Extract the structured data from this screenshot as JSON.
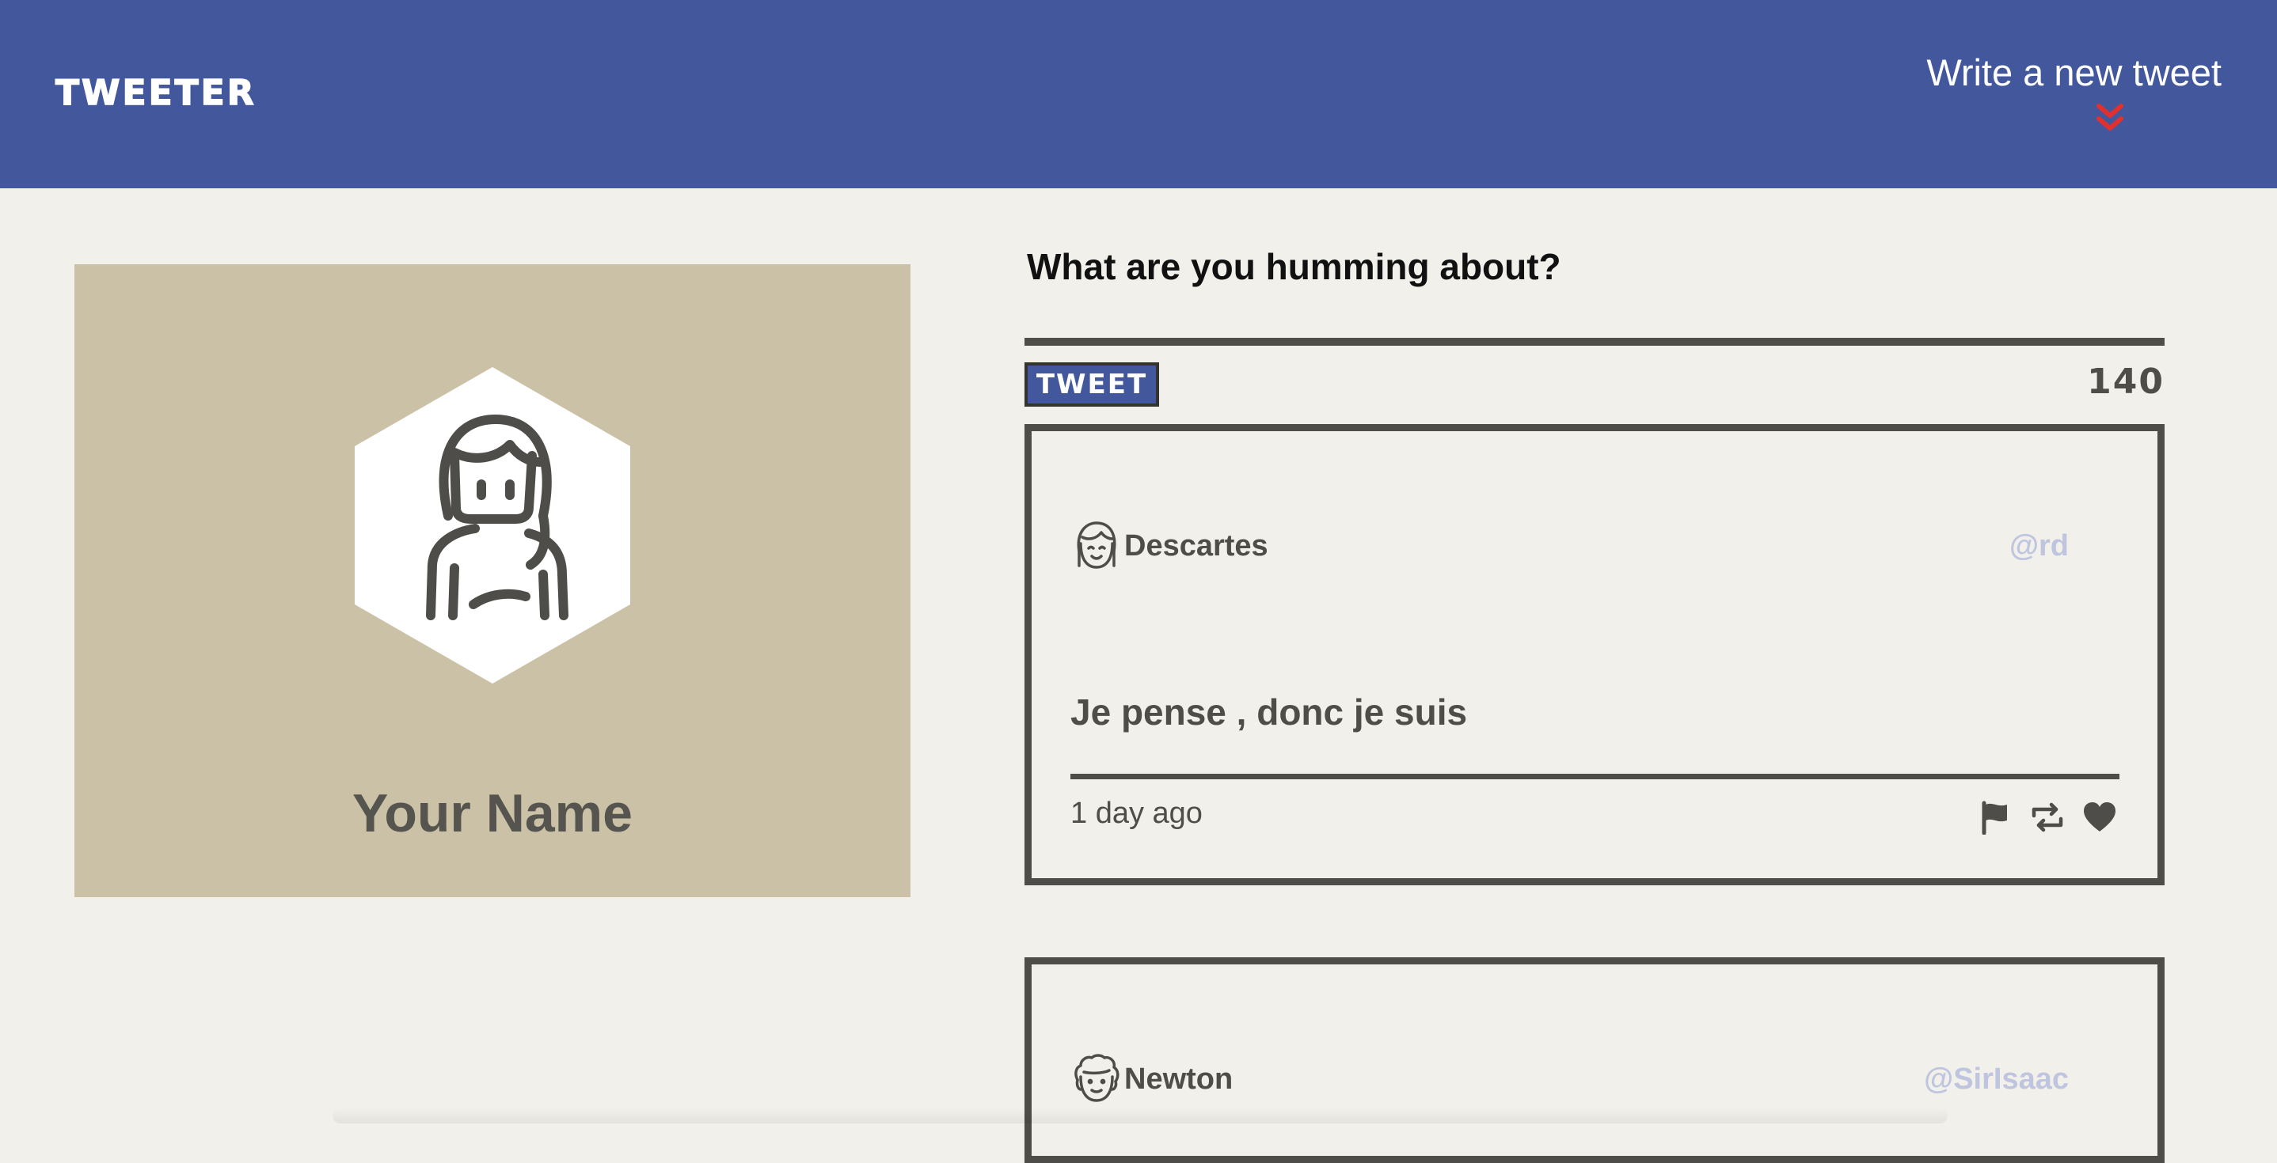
{
  "nav": {
    "brand": "TWEETER",
    "compose_label": "Write a new tweet",
    "compose_icon": "double-chevron-down-icon",
    "accent_color": "#e0312f",
    "background_color": "#43589c"
  },
  "profile": {
    "name": "Your Name",
    "avatar_icon": "woman-avatar-icon",
    "card_color": "#cbc1a6"
  },
  "composer": {
    "prompt": "What are you humming about?",
    "submit_label": "TWEET",
    "char_count": "140"
  },
  "tweets": [
    {
      "author": "Descartes",
      "handle": "@rd",
      "avatar_icon": "girl-avatar-icon",
      "text": "Je pense , donc je suis",
      "timestamp": "1 day ago",
      "actions": [
        "flag-icon",
        "retweet-icon",
        "heart-icon"
      ]
    },
    {
      "author": "Newton",
      "handle": "@SirIsaac",
      "avatar_icon": "curly-hair-avatar-icon"
    }
  ]
}
